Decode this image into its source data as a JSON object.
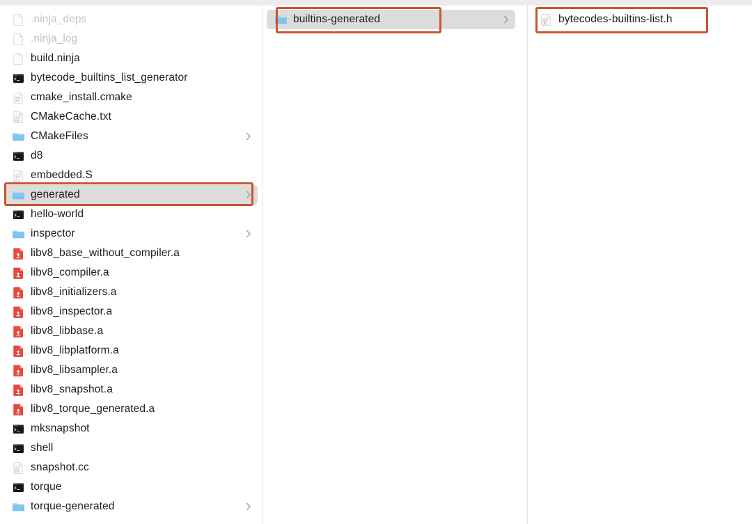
{
  "window": {
    "title": "Finder Column View",
    "view_mode": "column"
  },
  "columns": [
    {
      "name": "column-1",
      "items": [
        {
          "label": ".ninja_deps",
          "icon": "generic-file-icon",
          "dimmed": true,
          "selected": false,
          "has_chevron": false
        },
        {
          "label": ".ninja_log",
          "icon": "generic-file-icon",
          "dimmed": true,
          "selected": false,
          "has_chevron": false
        },
        {
          "label": "build.ninja",
          "icon": "generic-file-icon",
          "dimmed": false,
          "selected": false,
          "has_chevron": false
        },
        {
          "label": "bytecode_builtins_list_generator",
          "icon": "executable-icon",
          "dimmed": false,
          "selected": false,
          "has_chevron": false
        },
        {
          "label": "cmake_install.cmake",
          "icon": "script-file-icon",
          "dimmed": false,
          "selected": false,
          "has_chevron": false
        },
        {
          "label": "CMakeCache.txt",
          "icon": "text-file-icon",
          "dimmed": false,
          "selected": false,
          "has_chevron": false
        },
        {
          "label": "CMakeFiles",
          "icon": "folder-icon",
          "dimmed": false,
          "selected": false,
          "has_chevron": true
        },
        {
          "label": "d8",
          "icon": "executable-icon",
          "dimmed": false,
          "selected": false,
          "has_chevron": false
        },
        {
          "label": "embedded.S",
          "icon": "source-file-icon",
          "dimmed": false,
          "selected": false,
          "has_chevron": false
        },
        {
          "label": "generated",
          "icon": "folder-icon",
          "dimmed": false,
          "selected": true,
          "has_chevron": true
        },
        {
          "label": "hello-world",
          "icon": "executable-icon",
          "dimmed": false,
          "selected": false,
          "has_chevron": false
        },
        {
          "label": "inspector",
          "icon": "folder-icon",
          "dimmed": false,
          "selected": false,
          "has_chevron": true
        },
        {
          "label": "libv8_base_without_compiler.a",
          "icon": "archive-icon",
          "dimmed": false,
          "selected": false,
          "has_chevron": false
        },
        {
          "label": "libv8_compiler.a",
          "icon": "archive-icon",
          "dimmed": false,
          "selected": false,
          "has_chevron": false
        },
        {
          "label": "libv8_initializers.a",
          "icon": "archive-icon",
          "dimmed": false,
          "selected": false,
          "has_chevron": false
        },
        {
          "label": "libv8_inspector.a",
          "icon": "archive-icon",
          "dimmed": false,
          "selected": false,
          "has_chevron": false
        },
        {
          "label": "libv8_libbase.a",
          "icon": "archive-icon",
          "dimmed": false,
          "selected": false,
          "has_chevron": false
        },
        {
          "label": "libv8_libplatform.a",
          "icon": "archive-icon",
          "dimmed": false,
          "selected": false,
          "has_chevron": false
        },
        {
          "label": "libv8_libsampler.a",
          "icon": "archive-icon",
          "dimmed": false,
          "selected": false,
          "has_chevron": false
        },
        {
          "label": "libv8_snapshot.a",
          "icon": "archive-icon",
          "dimmed": false,
          "selected": false,
          "has_chevron": false
        },
        {
          "label": "libv8_torque_generated.a",
          "icon": "archive-icon",
          "dimmed": false,
          "selected": false,
          "has_chevron": false
        },
        {
          "label": "mksnapshot",
          "icon": "executable-icon",
          "dimmed": false,
          "selected": false,
          "has_chevron": false
        },
        {
          "label": "shell",
          "icon": "executable-icon",
          "dimmed": false,
          "selected": false,
          "has_chevron": false
        },
        {
          "label": "snapshot.cc",
          "icon": "cc-source-file-icon",
          "dimmed": false,
          "selected": false,
          "has_chevron": false
        },
        {
          "label": "torque",
          "icon": "executable-icon",
          "dimmed": false,
          "selected": false,
          "has_chevron": false
        },
        {
          "label": "torque-generated",
          "icon": "folder-icon",
          "dimmed": false,
          "selected": false,
          "has_chevron": true
        }
      ]
    },
    {
      "name": "column-2",
      "items": [
        {
          "label": "builtins-generated",
          "icon": "folder-icon",
          "dimmed": false,
          "selected": true,
          "has_chevron": true
        }
      ]
    },
    {
      "name": "column-3",
      "items": [
        {
          "label": "bytecodes-builtins-list.h",
          "icon": "header-file-icon",
          "dimmed": false,
          "selected": false,
          "has_chevron": false
        }
      ]
    }
  ],
  "annotations": [
    {
      "name": "annotation-generated",
      "target": "generated",
      "color": "#c8552f"
    },
    {
      "name": "annotation-builtins",
      "target": "builtins-generated",
      "color": "#c8552f"
    },
    {
      "name": "annotation-bytecodes",
      "target": "bytecodes-builtins-list.h",
      "color": "#c8552f"
    }
  ],
  "colors": {
    "annotation": "#c8552f",
    "selection_background": "#dcdcdc",
    "folder_blue": "#84c7f0",
    "archive_red": "#e8493c",
    "text": "#1d1d1f",
    "text_dimmed": "#c3c3c3",
    "divider": "#e3e3e3",
    "background": "#ffffff"
  }
}
